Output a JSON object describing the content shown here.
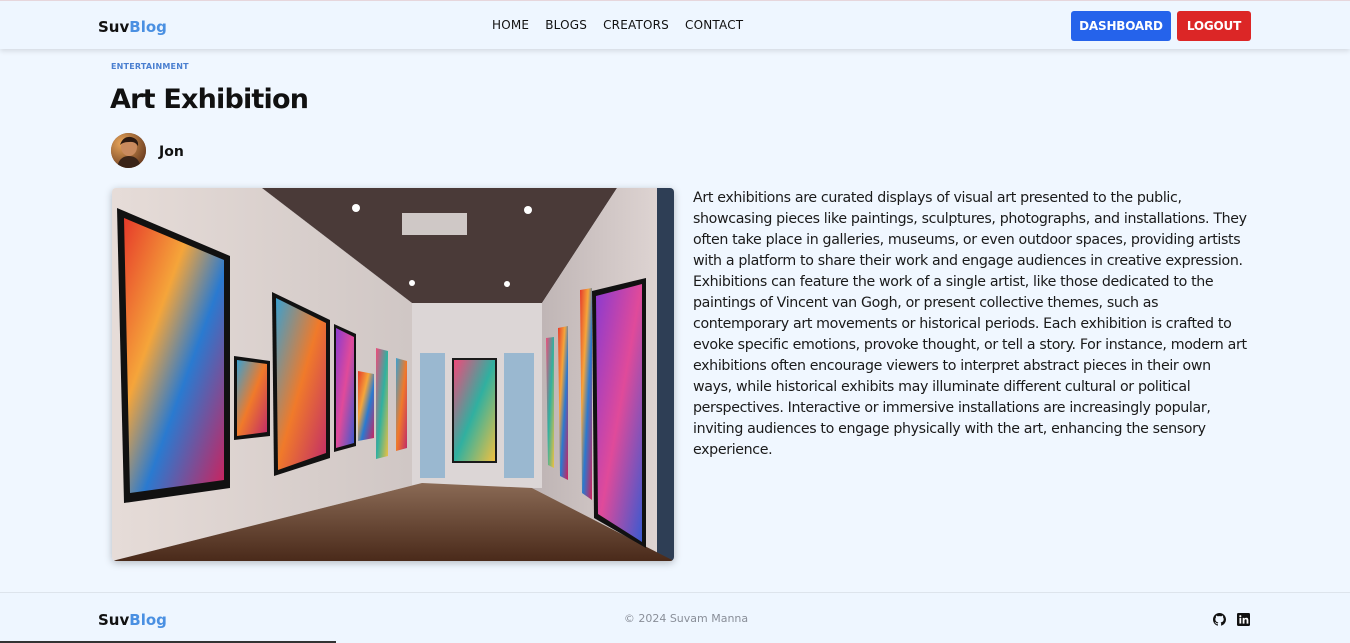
{
  "nav": {
    "logo_part1": "Suv",
    "logo_part2": "Blog",
    "links": [
      "HOME",
      "BLOGS",
      "CREATORS",
      "CONTACT"
    ],
    "dashboard_label": "DASHBOARD",
    "logout_label": "LOGOUT"
  },
  "post": {
    "category": "ENTERTAINMENT",
    "title": "Art Exhibition",
    "author": "Jon",
    "body": "Art exhibitions are curated displays of visual art presented to the public, showcasing pieces like paintings, sculptures, photographs, and installations. They often take place in galleries, museums, or even outdoor spaces, providing artists with a platform to share their work and engage audiences in creative expression. Exhibitions can feature the work of a single artist, like those dedicated to the paintings of Vincent van Gogh, or present collective themes, such as contemporary art movements or historical periods. Each exhibition is crafted to evoke specific emotions, provoke thought, or tell a story. For instance, modern art exhibitions often encourage viewers to interpret abstract pieces in their own ways, while historical exhibits may illuminate different cultural or political perspectives. Interactive or immersive installations are increasingly popular, inviting audiences to engage physically with the art, enhancing the sensory experience."
  },
  "footer": {
    "logo_part1": "Suv",
    "logo_part2": "Blog",
    "copyright": "© 2024 Suvam Manna",
    "icons": [
      "github-icon",
      "linkedin-icon"
    ]
  },
  "colors": {
    "background": "#f0f7ff",
    "accent": "#4a90e2",
    "dashboard": "#2563eb",
    "logout": "#dc2626"
  }
}
